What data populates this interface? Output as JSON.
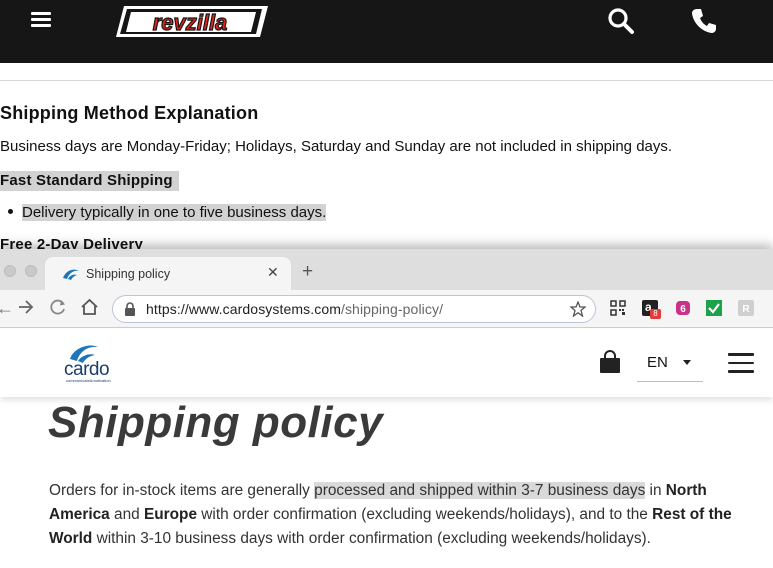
{
  "background_page": {
    "brand": "revzilla",
    "heading": "Shipping Method Explanation",
    "intro": "Business days are Monday-Friday; Holidays, Saturday and Sunday are not included in shipping days.",
    "fast_heading": "Fast Standard Shipping",
    "fast_item": "Delivery typically in one to five business days.",
    "free_heading": "Free 2-Day Delivery"
  },
  "browser": {
    "tab_title": "Shipping policy",
    "url_host": "https://www.cardosystems.com",
    "url_path": "/shipping-policy/",
    "extension_badge": "8"
  },
  "cardo_site": {
    "logo_text": "cardo",
    "logo_tagline": "communicate&motivation",
    "language": "EN",
    "page_title": "Shipping policy",
    "body": {
      "p1": "Orders for in-stock items are generally ",
      "p1_highlight": "processed and shipped within 3-7 business days",
      "p2": " in ",
      "na": "North America",
      "p3": " and ",
      "eu": "Europe",
      "p4": " with order confirmation (excluding weekends/holidays), and to the ",
      "row": "Rest of the World",
      "p5": " within 3-10 business days with order confirmation (excluding weekends/holidays)."
    }
  },
  "colors": {
    "revzilla_header": "#161616",
    "highlight": "#d2d2d2",
    "cardo_blue": "#1d76b8"
  }
}
